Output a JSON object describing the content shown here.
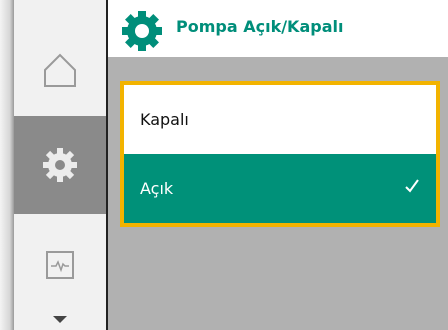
{
  "header": {
    "title": "Pompa Açık/Kapalı",
    "icon": "gear-icon"
  },
  "nav": {
    "items": [
      {
        "name": "home",
        "icon": "home-icon",
        "selected": false
      },
      {
        "name": "settings",
        "icon": "gear-icon",
        "selected": true
      },
      {
        "name": "monitor",
        "icon": "pulse-monitor-icon",
        "selected": false
      }
    ],
    "scroll_icon": "triangle-down-icon"
  },
  "options": [
    {
      "label": "Kapalı",
      "selected": false
    },
    {
      "label": "Açık",
      "selected": true,
      "indicator_icon": "checkmark-icon"
    }
  ],
  "colors": {
    "accent": "#008e7a",
    "selected_bg": "#009179",
    "focus_frame": "#f2b300",
    "content_bg": "#b1b1b1",
    "rail_selected": "#8a8a8a"
  }
}
